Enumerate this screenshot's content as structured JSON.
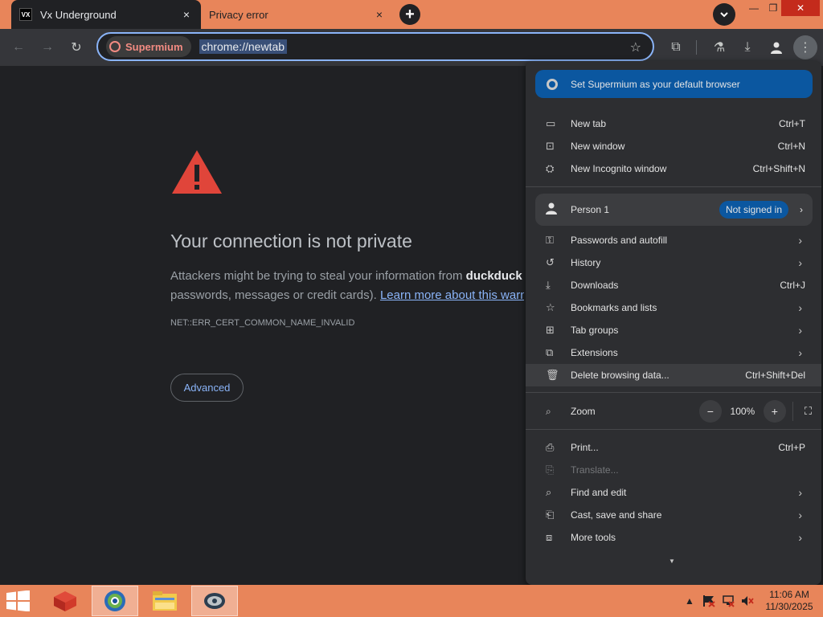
{
  "tabs": [
    {
      "favicon": "VX",
      "title": "Vx Underground",
      "close": "×"
    },
    {
      "title": "Privacy error",
      "close": "×"
    }
  ],
  "tabstrip": {
    "new_tab": "+",
    "tab_search": "⌄",
    "minimize": "—",
    "maximize": "❐",
    "close": "✕"
  },
  "toolbar": {
    "back": "←",
    "forward": "→",
    "reload": "↻",
    "chip_label": "Supermium",
    "url": "chrome://newtab",
    "bookmark_star": "☆",
    "extensions": "⧉",
    "labs": "⚗",
    "downloads": "⤓",
    "profile": "●",
    "menu": "⋮"
  },
  "error_page": {
    "title": "Your connection is not private",
    "body_prefix": "Attackers might be trying to steal your information from ",
    "domain": "duckduck",
    "body_line2": "passwords, messages or credit cards). ",
    "learn_more": "Learn more about this warnin",
    "error_code": "NET::ERR_CERT_COMMON_NAME_INVALID",
    "advanced": "Advanced"
  },
  "menu": {
    "banner": "Set Supermium as your default browser",
    "new_tab": {
      "label": "New tab",
      "shortcut": "Ctrl+T",
      "icon": "new-tab-icon"
    },
    "new_window": {
      "label": "New window",
      "shortcut": "Ctrl+N",
      "icon": "new-window-icon"
    },
    "incognito": {
      "label": "New Incognito window",
      "shortcut": "Ctrl+Shift+N",
      "icon": "incognito-icon"
    },
    "profile": {
      "name": "Person 1",
      "status": "Not signed in"
    },
    "passwords": {
      "label": "Passwords and autofill"
    },
    "history": {
      "label": "History"
    },
    "downloads": {
      "label": "Downloads",
      "shortcut": "Ctrl+J"
    },
    "bookmarks": {
      "label": "Bookmarks and lists"
    },
    "tab_groups": {
      "label": "Tab groups"
    },
    "extensions": {
      "label": "Extensions"
    },
    "delete_data": {
      "label": "Delete browsing data...",
      "shortcut": "Ctrl+Shift+Del"
    },
    "zoom": {
      "label": "Zoom",
      "minus": "−",
      "value": "100%",
      "plus": "+"
    },
    "print": {
      "label": "Print...",
      "shortcut": "Ctrl+P"
    },
    "translate": {
      "label": "Translate..."
    },
    "find_edit": {
      "label": "Find and edit"
    },
    "cast": {
      "label": "Cast, save and share"
    },
    "more_tools": {
      "label": "More tools"
    },
    "chevron": "›"
  },
  "taskbar": {
    "time": "11:06 AM",
    "date": "11/30/2025",
    "tray_arrow": "▲"
  },
  "colors": {
    "accent": "#8ab4f8",
    "titlebar": "#e8855a",
    "warning_red": "#e0453a",
    "banner": "#0b57a0"
  }
}
